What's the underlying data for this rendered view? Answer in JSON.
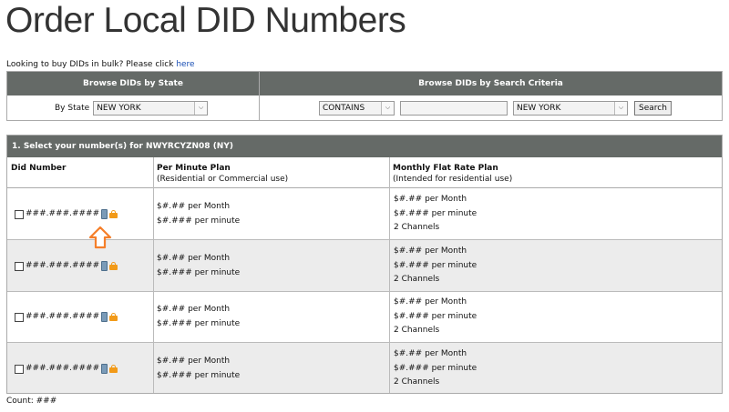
{
  "page": {
    "title": "Order Local DID Numbers",
    "bulk_text": "Looking to buy DIDs in bulk? Please click",
    "bulk_link": "here"
  },
  "browse": {
    "state_header": "Browse DIDs by State",
    "criteria_header": "Browse DIDs by Search Criteria",
    "by_state_label": "By State",
    "state_value": "NEW YORK",
    "match_value": "CONTAINS",
    "search_value": "",
    "criteria_state_value": "NEW YORK",
    "search_button": "Search"
  },
  "results": {
    "header": "1. Select your number(s) for NWYRCYZN08 (NY)",
    "col_did": "Did Number",
    "col_per_minute": "Per Minute Plan",
    "col_per_minute_sub": "(Residential or Commercial use)",
    "col_flat": "Monthly Flat Rate Plan",
    "col_flat_sub": "(Intended for residential use)",
    "rows": [
      {
        "number": "###.###.####",
        "pm_month": "$#.## per Month",
        "pm_minute": "$#.### per minute",
        "fr_month": "$#.## per Month",
        "fr_minute": "$#.### per minute",
        "fr_channels": "2 Channels"
      },
      {
        "number": "###.###.####",
        "pm_month": "$#.## per Month",
        "pm_minute": "$#.### per minute",
        "fr_month": "$#.## per Month",
        "fr_minute": "$#.### per minute",
        "fr_channels": "2 Channels"
      },
      {
        "number": "###.###.####",
        "pm_month": "$#.## per Month",
        "pm_minute": "$#.### per minute",
        "fr_month": "$#.## per Month",
        "fr_minute": "$#.### per minute",
        "fr_channels": "2 Channels"
      },
      {
        "number": "###.###.####",
        "pm_month": "$#.## per Month",
        "pm_minute": "$#.### per minute",
        "fr_month": "$#.## per Month",
        "fr_minute": "$#.### per minute",
        "fr_channels": "2 Channels"
      }
    ],
    "count_label": "Count: ###"
  },
  "colors": {
    "header_bg": "#656a67",
    "alt_row": "#ececec",
    "link": "#1a4fb5",
    "lock": "#f29a18",
    "arrow": "#f57f2a"
  },
  "icons": [
    "checkbox",
    "phone-icon",
    "lock-icon",
    "up-arrow-icon"
  ]
}
